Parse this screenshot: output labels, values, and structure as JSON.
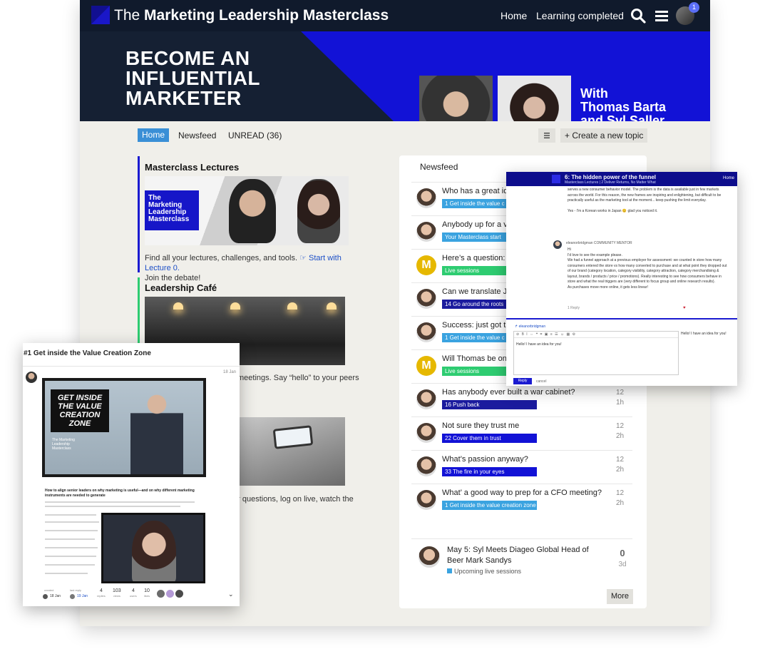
{
  "app": {
    "title_prefix": "The",
    "title_main": "Marketing Leadership Masterclass",
    "nav_home": "Home",
    "nav_learning": "Learning completed",
    "notification_count": "1"
  },
  "banner": {
    "headline": "BECOME AN INFLUENTIAL MARKETER",
    "with_line1": "With",
    "with_line2": "Thomas Barta",
    "with_line3": "and Syl Saller"
  },
  "subnav": {
    "home": "Home",
    "newsfeed": "Newsfeed",
    "unread": "UNREAD (36)",
    "create_topic": "Create a new topic"
  },
  "categories": {
    "lectures_title": "Masterclass Lectures",
    "lectures_image_text": "The Marketing Leadership Masterclass",
    "lectures_desc": "Find all your lectures, challenges, and tools.",
    "lectures_link": "☞ Start with Lecture 0.",
    "lectures_desc2": "Join the debate!",
    "cafe_title": "Leadership Café",
    "cafe_desc_visible": "meetings. Say “hello” to your peers",
    "live_desc_visible": "ur questions, log on live, watch the"
  },
  "newsfeed": {
    "title": "Newsfeed",
    "rows": [
      {
        "q": "Who has a great idea",
        "tag": "1 Get inside the value c",
        "tag_color": "#3aa3e0",
        "replies": "",
        "ago": "",
        "avatar": "face"
      },
      {
        "q": "Anybody up for a virt",
        "tag": "Your Masterclass start",
        "tag_color": "#3aa3e0",
        "replies": "",
        "ago": "",
        "avatar": "face"
      },
      {
        "q": "Here’s a question: wh",
        "tag": "Live sessions",
        "tag_color": "#2ecc71",
        "replies": "",
        "ago": "",
        "avatar": "M"
      },
      {
        "q": "Can we translate Jap",
        "tag": "14 Go around the roots",
        "tag_color": "#1b1b9e",
        "replies": "",
        "ago": "",
        "avatar": "face"
      },
      {
        "q": "Success: just got the",
        "tag": "1 Get inside the value c",
        "tag_color": "#3aa3e0",
        "replies": "",
        "ago": "",
        "avatar": "face"
      },
      {
        "q": "Will Thomas be on A",
        "tag": "Live sessions",
        "tag_color": "#2ecc71",
        "replies": "",
        "ago": "",
        "avatar": "M"
      },
      {
        "q": "Has anybody ever built a war cabinet?",
        "tag": "16 Push back",
        "tag_color": "#1b1b9e",
        "replies": "12",
        "ago": "1h",
        "avatar": "face"
      },
      {
        "q": "Not sure they trust me",
        "tag": "22 Cover them in trust",
        "tag_color": "#1212d6",
        "replies": "12",
        "ago": "2h",
        "avatar": "face"
      },
      {
        "q": "What’s passion anyway?",
        "tag": "33 The fire in your eyes",
        "tag_color": "#1212d6",
        "replies": "12",
        "ago": "2h",
        "avatar": "face"
      },
      {
        "q": "What’ a good way to prep for a CFO meeting?",
        "tag": "1 Get inside the value creation zone",
        "tag_color": "#3aa3e0",
        "replies": "12",
        "ago": "2h",
        "avatar": "face"
      }
    ],
    "live": {
      "title": "May 5: Syl Meets Diageo Global Head of Beer Mark Sandys",
      "category": "Upcoming live sessions",
      "replies": "0",
      "ago": "3d"
    },
    "more": "More"
  },
  "topic_overlay": {
    "title": "6: The hidden power of the funnel",
    "subtitle": "Masterclass Lectures  |  2 Deliver Returns, No Matter What",
    "home": "Home",
    "body1": "serves a new consumer behavior model. The problem is the data is available just in few markets across the world. For this reason, the new frames are inspiring and enlightening, but difficult to be practically useful as the marketing tool at the moment... keep pushing the limit everyday.",
    "body2": "Yes - I'm a Korean works in Japan 😊 glad you noticed it.",
    "user": "eleanorbridgman  COMMUNITY MENTOR",
    "reply_body": "Hi\nI'd love to see the example please.\nWe had a funnel approach at a previous employer for assessment: we counted in store how many consumers entered the store vs how many converted to purchase and at what point they dropped out of our brand (category location, category visibility, category attraction, category merchandising & layout, brands / products / price / promotions). Really interesting to see how consumers behave in store and what the real triggers are (very different to focus group and online research results).\nAs purchases move more online, it gets less linear!",
    "actions": "1 Reply",
    "reply_to": "eleanorbridgman",
    "editor_text": "Hello!  I have an idea for you!",
    "preview_text": "Hello!  I have an idea for you!",
    "reply_button": "Reply",
    "cancel": "cancel"
  },
  "lecture_overlay": {
    "title": "#1 Get inside the Value Creation Zone",
    "date": "18 Jan",
    "video_sign": "GET INSIDE THE VALUE CREATION ZONE",
    "video_brand": "The Marketing Leadership Masterclass",
    "heading": "How to align senior leaders on why marketing is useful—and on why different marketing instruments are needed to generate",
    "created_label": "created",
    "created_date": "18 Jan",
    "last_reply_label": "last reply",
    "last_reply_date": "19 Jan",
    "replies": "4",
    "replies_label": "replies",
    "views": "103",
    "views_label": "views",
    "users": "4",
    "users_label": "users",
    "likes": "10",
    "likes_label": "likes"
  }
}
